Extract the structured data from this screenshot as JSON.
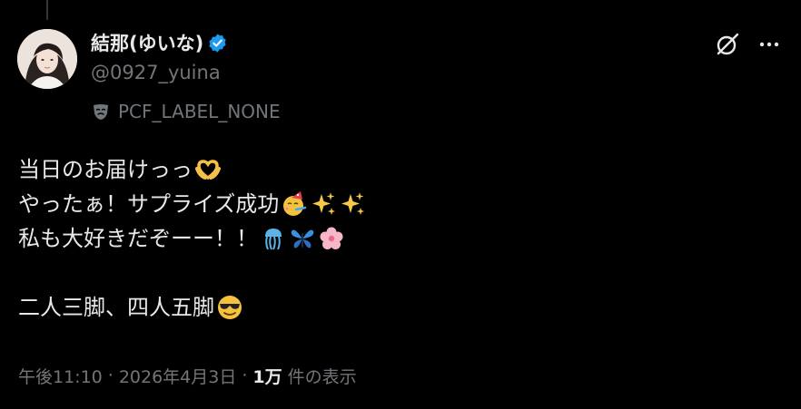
{
  "post": {
    "author": {
      "display_name": "結那(ゆいな)",
      "handle": "@0927_yuina",
      "verified": true
    },
    "label": "PCF_LABEL_NONE",
    "lines": [
      "当日のお届けっっ",
      "やったぁ！サプライズ成功",
      "私も大好きだぞーー！！",
      "",
      "二人三脚、四人五脚"
    ],
    "emojis": {
      "line1": [
        "heart-hands"
      ],
      "line2": [
        "partying-face",
        "sparkles",
        "sparkles"
      ],
      "line3": [
        "jellyfish",
        "butterfly",
        "cherry-blossom"
      ],
      "line5": [
        "smiling-face-with-sunglasses"
      ]
    },
    "time": "午後11:10",
    "separator": "·",
    "date": "2026年4月3日",
    "views_count": "1万",
    "views_label": "件の表示"
  },
  "colors": {
    "background": "#000000",
    "primary_text": "#e7e9ea",
    "secondary_text": "#71767b",
    "verified_blue": "#1d9bf0"
  }
}
